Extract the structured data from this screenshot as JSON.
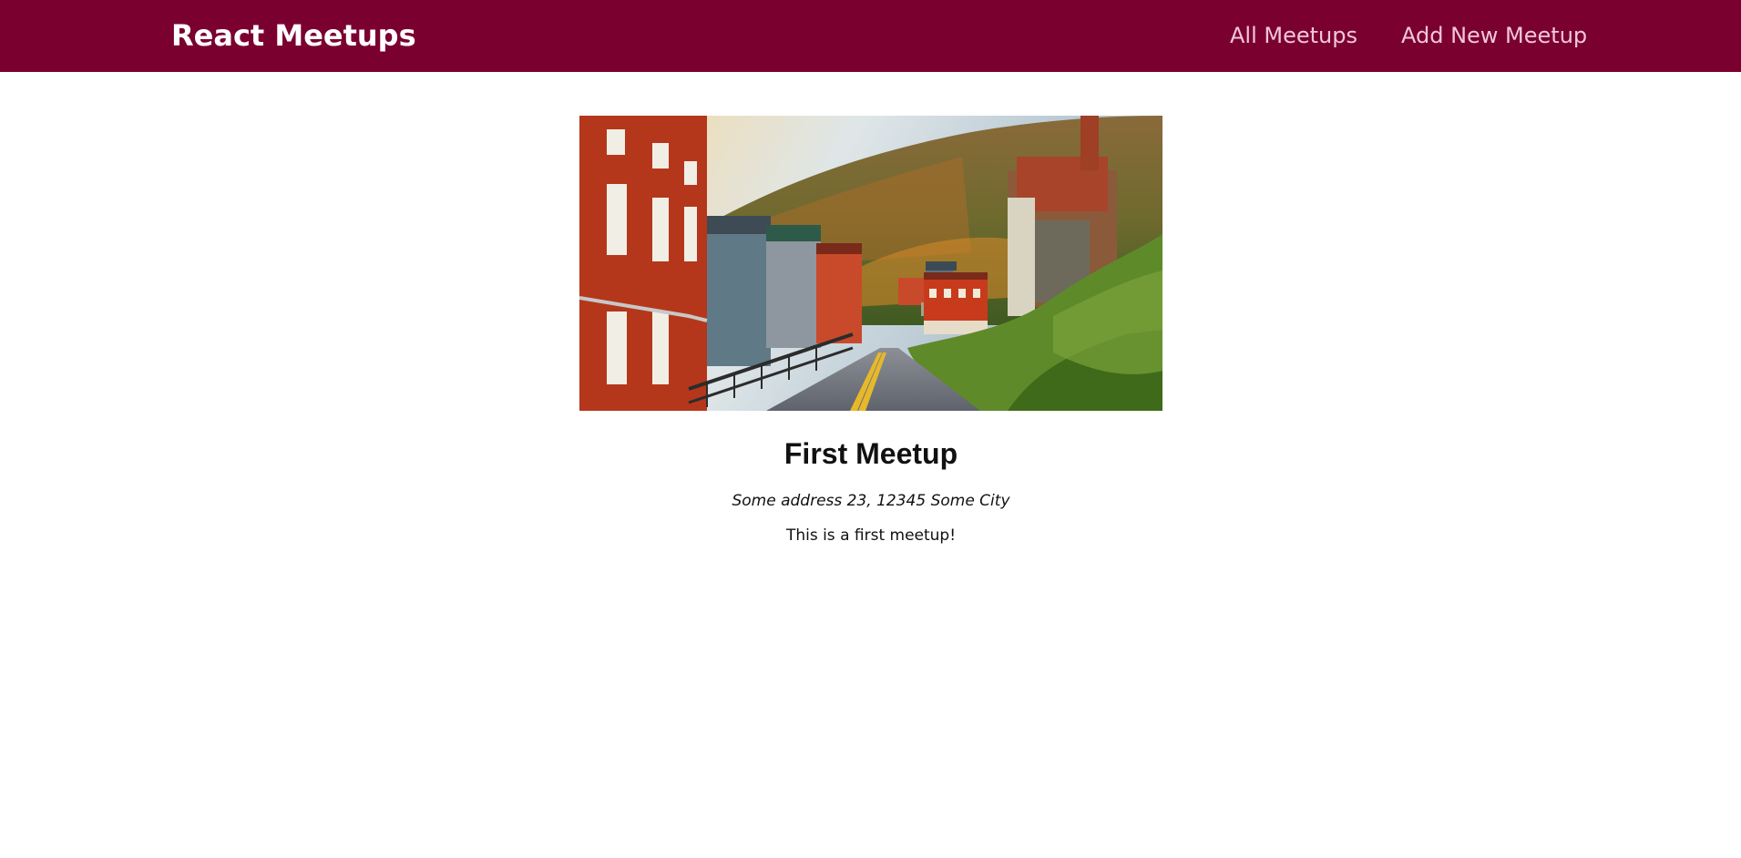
{
  "header": {
    "logo": "React Meetups",
    "nav": {
      "all_meetups": "All Meetups",
      "add_new_meetup": "Add New Meetup"
    }
  },
  "meetup": {
    "image_alt": "First Meetup",
    "title": "First Meetup",
    "address": "Some address 23, 12345 Some City",
    "description": "This is a first meetup!"
  },
  "colors": {
    "header_background": "#7a0030",
    "nav_link": "#f2c6da",
    "logo": "#ffffff"
  }
}
